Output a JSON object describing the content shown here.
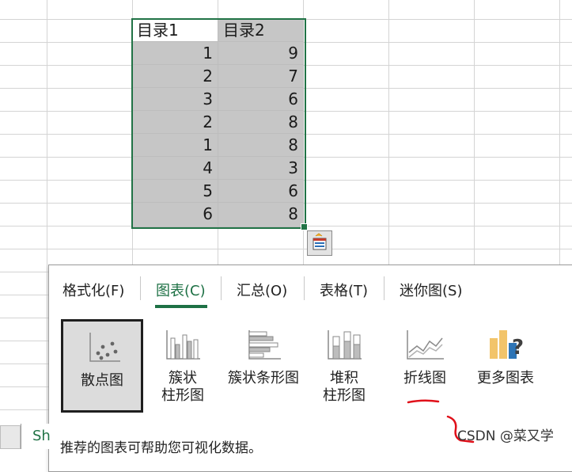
{
  "spreadsheet": {
    "headers": [
      "目录1",
      "目录2"
    ],
    "rows": [
      [
        "1",
        "9"
      ],
      [
        "2",
        "7"
      ],
      [
        "3",
        "6"
      ],
      [
        "2",
        "8"
      ],
      [
        "1",
        "8"
      ],
      [
        "4",
        "3"
      ],
      [
        "5",
        "6"
      ],
      [
        "6",
        "8"
      ]
    ]
  },
  "quick_analysis": {
    "tabs": [
      {
        "label": "格式化(F)"
      },
      {
        "label": "图表(C)"
      },
      {
        "label": "汇总(O)"
      },
      {
        "label": "表格(T)"
      },
      {
        "label": "迷你图(S)"
      }
    ],
    "active_tab": "图表(C)",
    "charts": [
      {
        "label": "散点图",
        "icon": "scatter-chart-icon"
      },
      {
        "label": "簇状\n柱形图",
        "icon": "clustered-column-icon"
      },
      {
        "label": "簇状条形图",
        "icon": "clustered-bar-icon"
      },
      {
        "label": "堆积\n柱形图",
        "icon": "stacked-column-icon"
      },
      {
        "label": "折线图",
        "icon": "line-chart-icon"
      },
      {
        "label": "更多图表",
        "icon": "more-charts-icon"
      }
    ],
    "selected_chart": "散点图",
    "description": "推荐的图表可帮助您可视化数据。"
  },
  "sheet_tab_label": "Sh",
  "watermark": "CSDN @菜又学",
  "colors": {
    "excel_green": "#217346",
    "annotation_red": "#e0101a",
    "selection_fill": "#c6c6c6"
  }
}
